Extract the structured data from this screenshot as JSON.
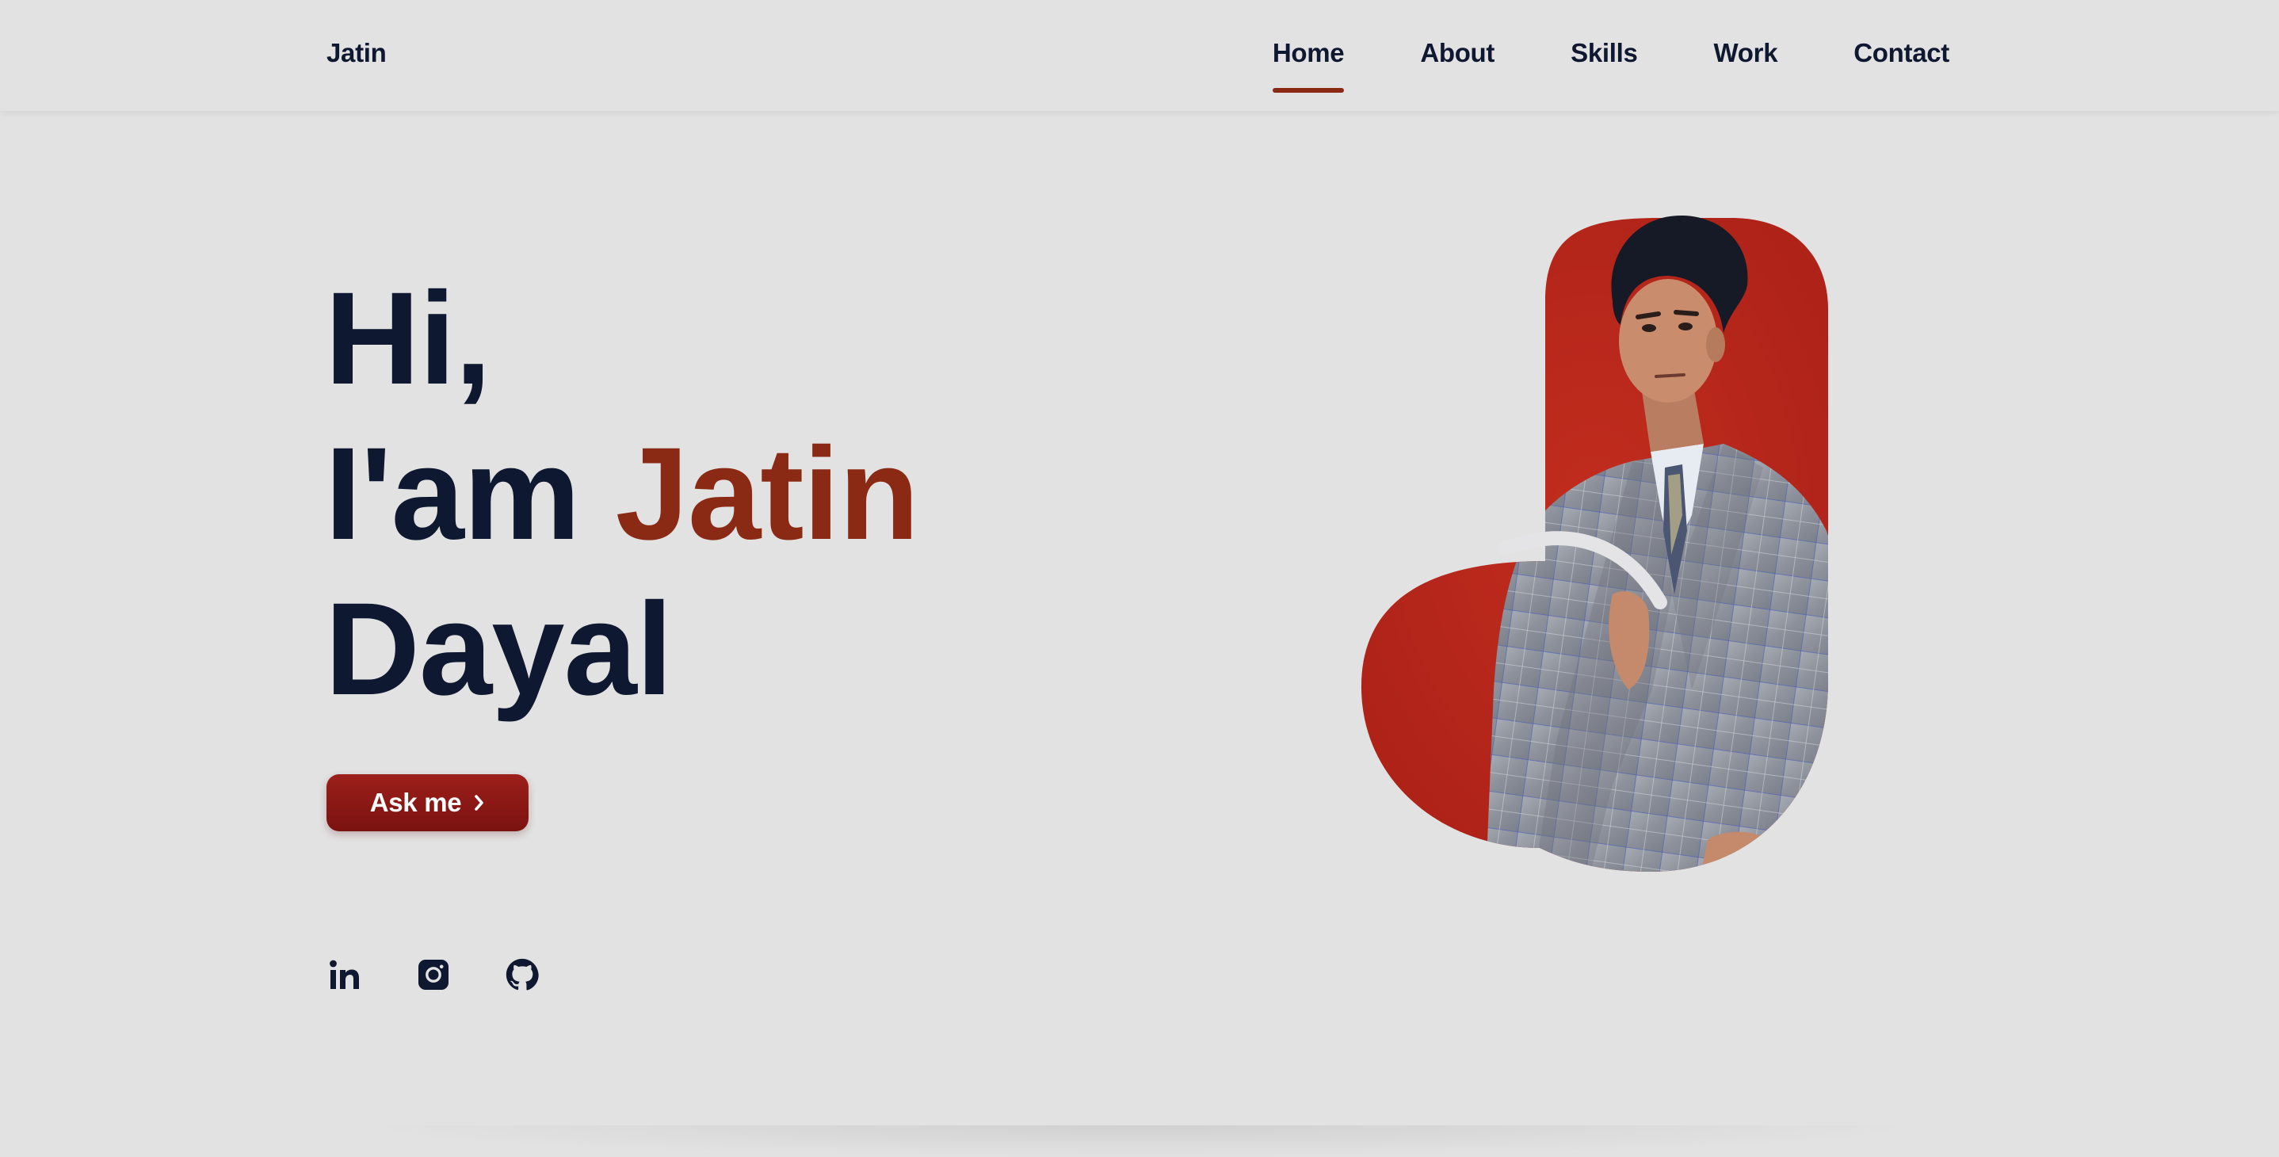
{
  "header": {
    "logo": "Jatin",
    "nav": [
      {
        "label": "Home",
        "active": true
      },
      {
        "label": "About",
        "active": false
      },
      {
        "label": "Skills",
        "active": false
      },
      {
        "label": "Work",
        "active": false
      },
      {
        "label": "Contact",
        "active": false
      }
    ]
  },
  "hero": {
    "line1": "Hi,",
    "line2_prefix": "I'am",
    "line2_name": "Jatin",
    "line3": "Dayal",
    "cta_label": "Ask me",
    "cta_icon": "chevron-right-icon"
  },
  "socials": [
    {
      "icon": "linkedin-icon"
    },
    {
      "icon": "instagram-icon"
    },
    {
      "icon": "github-icon"
    }
  ],
  "colors": {
    "background": "#e2e2e2",
    "text": "#0e1830",
    "accent": "#8b2a14",
    "button": "#8a1714",
    "blob": "#b5241a"
  }
}
